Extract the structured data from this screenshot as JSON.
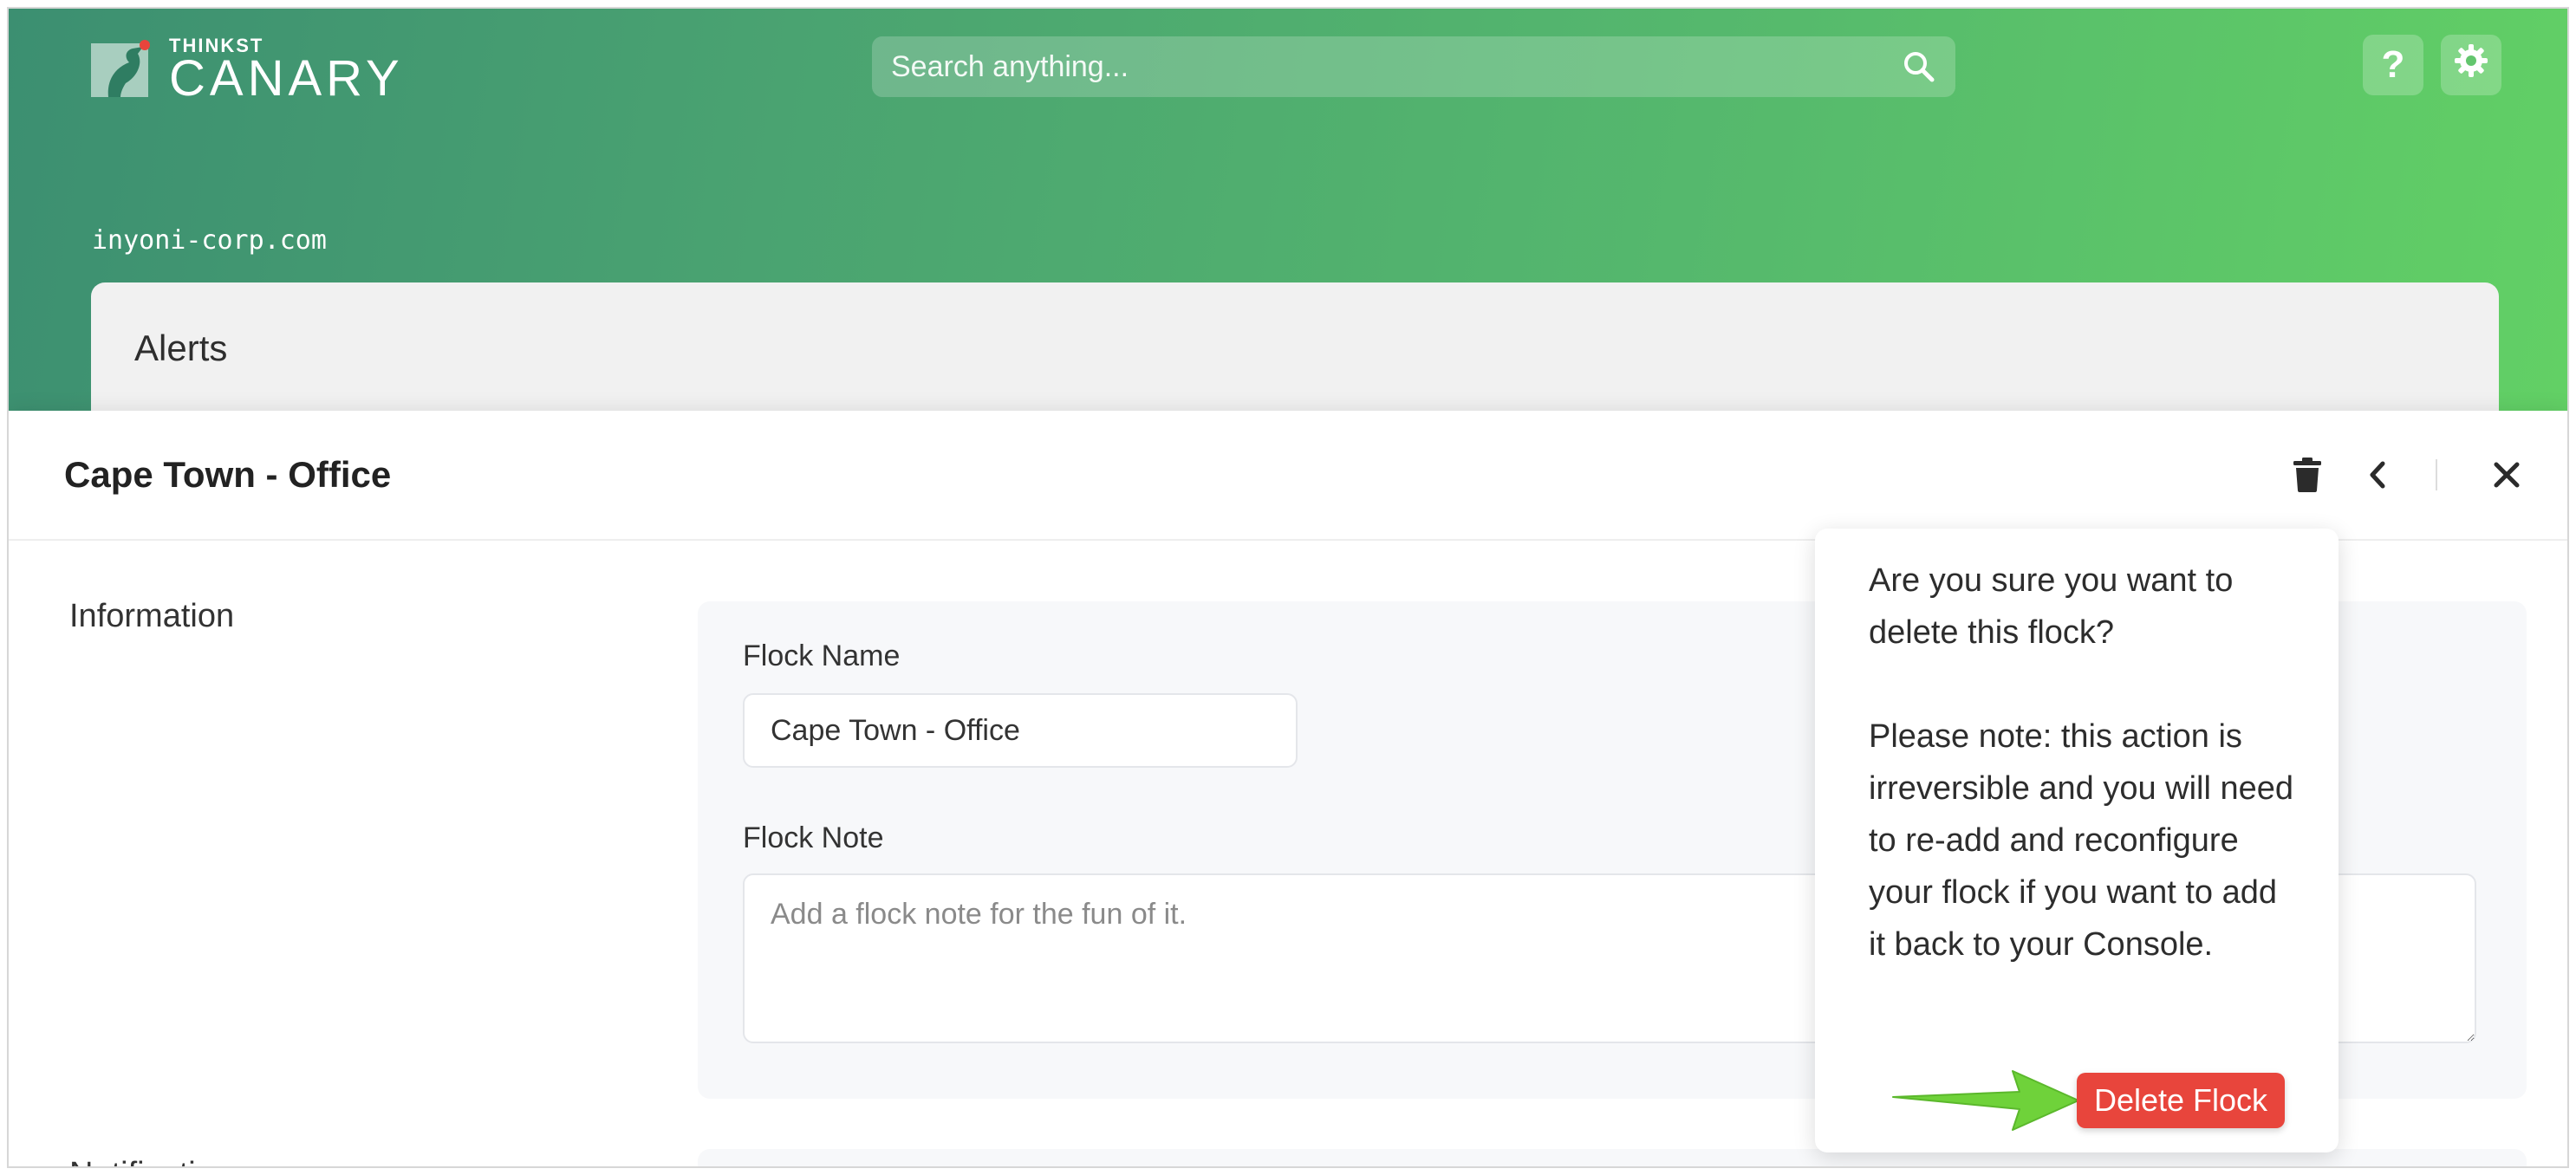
{
  "brand": {
    "small": "THINKST",
    "big": "CANARY"
  },
  "search": {
    "placeholder": "Search anything..."
  },
  "header": {
    "help_label": "?"
  },
  "domain": "inyoni-corp.com",
  "alerts": {
    "title": "Alerts"
  },
  "panel": {
    "title": "Cape Town - Office",
    "sections": {
      "information": "Information",
      "notifications": "Notifications"
    },
    "fields": {
      "flock_name_label": "Flock Name",
      "flock_name_value": "Cape Town - Office",
      "flock_note_label": "Flock Note",
      "flock_note_placeholder": "Add a flock note for the fun of it."
    }
  },
  "confirm": {
    "question": "Are you sure you want to delete this flock?",
    "note": "Please note: this action is irreversible and you will need to re-add and reconfigure your flock if you want to add it back to your Console.",
    "delete_label": "Delete Flock"
  },
  "colors": {
    "accent_green": "#55b86d",
    "danger": "#e8453c",
    "arrow": "#6fd23a"
  },
  "icons": [
    "canary-logo-icon",
    "search-icon",
    "gear-icon",
    "trash-icon",
    "chevron-left-icon",
    "close-icon",
    "arrow-icon"
  ]
}
